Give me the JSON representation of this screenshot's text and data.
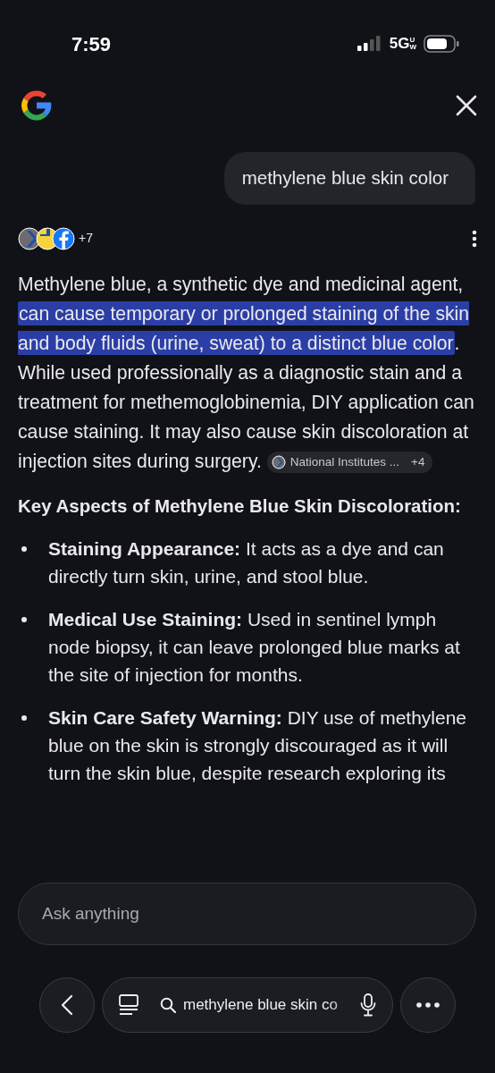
{
  "status_bar": {
    "time": "7:59",
    "network": "5G",
    "network_sub": "UW"
  },
  "query": "methylene blue skin color",
  "sources": {
    "more": "+7"
  },
  "answer": {
    "segments": [
      {
        "text": "Methylene blue, a synthetic dye and medicinal agent, ",
        "highlighted": false
      },
      {
        "text": "can cause temporary or prolonged staining of the skin and body fluids (urine, sweat) to a distinct blue color",
        "highlighted": true
      },
      {
        "text": ". While used professionally as a diagnostic stain and a treatment for methemoglobinemia, DIY application can cause staining. It may also cause skin discoloration at injection sites during surgery.",
        "highlighted": false
      }
    ],
    "citation": {
      "label": "National Institutes ...",
      "more": "+4"
    }
  },
  "heading": "Key Aspects of Methylene Blue Skin Discoloration:",
  "bullets": [
    {
      "text": "**Staining Appearance:** It acts as a dye and can directly turn skin, urine, and stool blue."
    },
    {
      "text": "**Medical Use Staining:** Used in sentinel lymph node biopsy, it can leave prolonged blue marks at the site of injection for months."
    },
    {
      "text": "**Skin Care Safety Warning:** DIY use of methylene blue on the skin is strongly discouraged as it will turn the skin blue, despite research exploring its"
    }
  ],
  "ask_field": {
    "placeholder": "Ask anything"
  },
  "bottom_bar": {
    "search_text": "methylene blue skin co"
  }
}
